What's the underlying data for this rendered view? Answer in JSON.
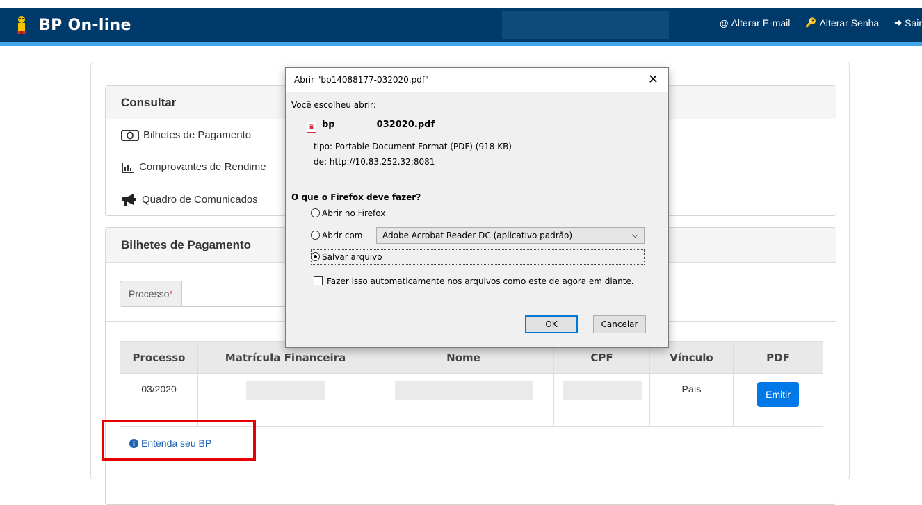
{
  "header": {
    "brand": "BP On-line",
    "links": [
      {
        "icon": "at-icon",
        "glyph": "@",
        "label": "Alterar E-mail"
      },
      {
        "icon": "key-icon",
        "glyph": "🔑",
        "label": "Alterar Senha"
      },
      {
        "icon": "sign-out-icon",
        "glyph": "➜",
        "label": "Sair"
      }
    ]
  },
  "consultar": {
    "title": "Consultar",
    "items": [
      {
        "icon": "money-icon",
        "label": "Bilhetes de Pagamento"
      },
      {
        "icon": "bar-chart-icon",
        "label": "Comprovantes de Rendime"
      },
      {
        "icon": "bullhorn-icon",
        "label": "Quadro de Comunicados"
      }
    ]
  },
  "bilhetes": {
    "title": "Bilhetes de Pagamento",
    "processo_label": "Processo",
    "required_mark": "*",
    "table": {
      "headers": [
        "Processo",
        "Matrícula Financeira",
        "Nome",
        "CPF",
        "Vínculo",
        "PDF"
      ],
      "rows": [
        {
          "processo": "03/2020",
          "vinculo": "País",
          "pdf": "Emitir"
        }
      ]
    }
  },
  "footer": {
    "link": "Entenda seu BP"
  },
  "dialog": {
    "title": "Abrir \"bp14088177-032020.pdf\"",
    "close": "✕",
    "chose_label": "Você escolheu abrir:",
    "file_prefix": "bp",
    "file_suffix": "032020.pdf",
    "tipo_label": "tipo:",
    "tipo_value": "Portable Document Format (PDF) (918 KB)",
    "de_label": "de:",
    "de_value": "http://10.83.252.32:8081",
    "question": "O que o Firefox deve fazer?",
    "opt_open_firefox": "Abrir no Firefox",
    "opt_open_with": "Abrir com",
    "open_with_app": "Adobe Acrobat Reader DC (aplicativo padrão)",
    "opt_save": "Salvar arquivo",
    "selected_option": "save",
    "auto_label": "Fazer isso automaticamente nos arquivos como este de agora em diante.",
    "ok": "OK",
    "cancel": "Cancelar"
  },
  "colors": {
    "header_bg": "#003a6b",
    "header_accent": "#42a5e8",
    "primary_button": "#0078e7",
    "highlight_box": "#e60000"
  }
}
